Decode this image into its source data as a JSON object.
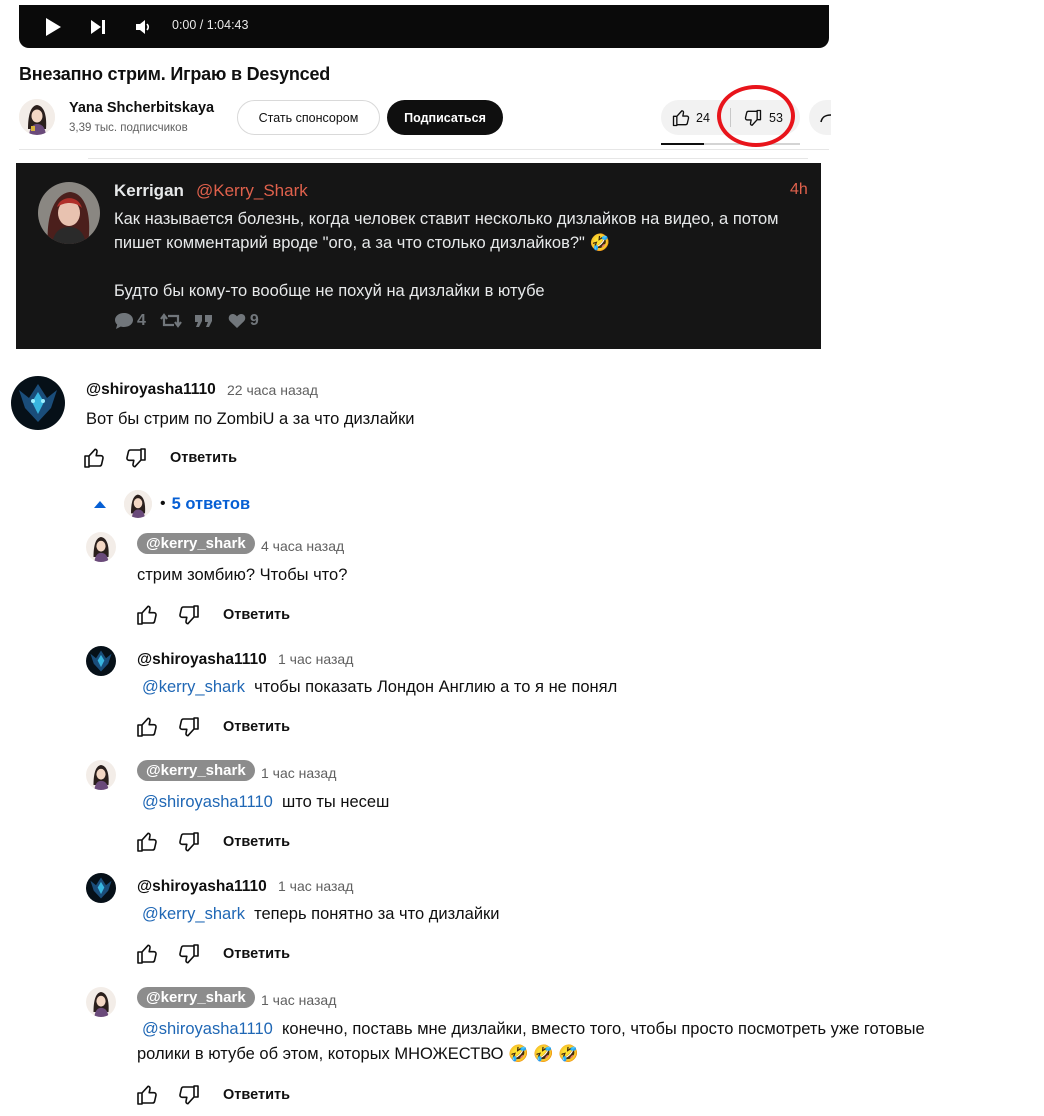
{
  "player": {
    "time": "0:00 / 1:04:43"
  },
  "video": {
    "title": "Внезапно стрим. Играю в Desynced"
  },
  "channel": {
    "name": "Yana Shcherbitskaya",
    "subscribers": "3,39 тыс. подписчиков",
    "sponsor_label": "Стать спонсором",
    "subscribe_label": "Подписаться"
  },
  "rating": {
    "likes": "24",
    "dislikes": "53",
    "like_fraction": 0.31
  },
  "tweet": {
    "name": "Kerrigan",
    "handle": "@Kerry_Shark",
    "time": "4h",
    "text_1": "Как называется болезнь, когда человек ставит несколько дизлайков на видео, а потом пишет комментарий вроде \"ого, а за что столько дизлайков?\" 🤣",
    "text_2": "Будто бы кому-то вообще не похуй на дизлайки в ютубе",
    "replies": "4",
    "likes": "9"
  },
  "reply_label": "Ответить",
  "replies_toggle": {
    "dot": "•",
    "count_label": "5 ответов"
  },
  "comment": {
    "author": "@shiroyasha1110",
    "time": "22 часа назад",
    "text": "Вот бы стрим по ZombiU а за что дизлайки"
  },
  "replies": [
    {
      "author": "@kerry_shark",
      "time": "4 часа назад",
      "mention": "",
      "text": "стрим зомбию? Чтобы что?"
    },
    {
      "author": "@shiroyasha1110",
      "time": "1 час назад",
      "mention": "@kerry_shark",
      "text": "чтобы показать Лондон Англию а то я не понял"
    },
    {
      "author": "@kerry_shark",
      "time": "1 час назад",
      "mention": "@shiroyasha1110",
      "text": "што ты несеш"
    },
    {
      "author": "@shiroyasha1110",
      "time": "1 час назад",
      "mention": "@kerry_shark",
      "text": "теперь понятно за что дизлайки"
    },
    {
      "author": "@kerry_shark",
      "time": "1 час назад",
      "mention": "@shiroyasha1110",
      "text": "конечно, поставь мне дизлайки, вместо того, чтобы просто посмотреть уже готовые",
      "text_line2": "ролики в ютубе об этом, которых МНОЖЕСТВО 🤣 🤣 🤣"
    }
  ],
  "colors": {
    "accent_red": "#e8141b",
    "link_blue": "#1f67b5",
    "tweet_accent": "#e0614c"
  }
}
